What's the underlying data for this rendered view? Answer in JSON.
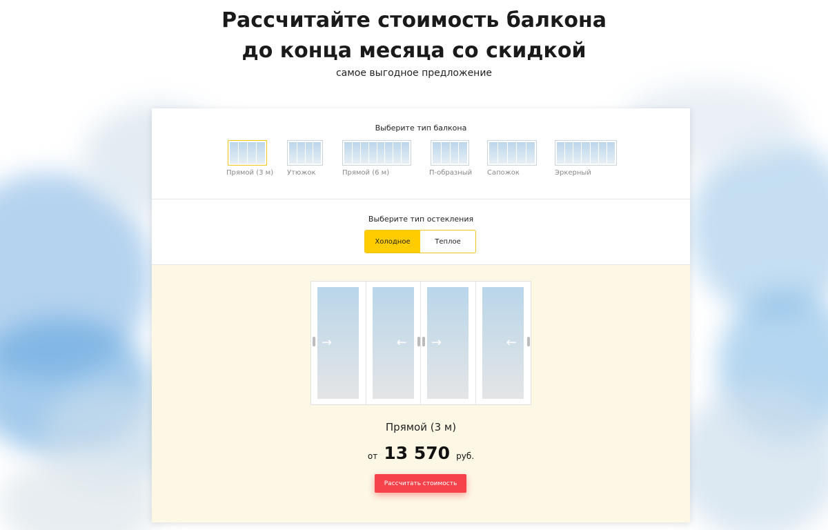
{
  "header": {
    "title_line1": "Рассчитайте стоимость балкона",
    "title_line2": "до конца месяца со скидкой",
    "subtitle": "самое выгодное предложение"
  },
  "balcony_type": {
    "label": "Выберите тип балкона",
    "options": [
      {
        "label": "Прямой (3 м)",
        "selected": true
      },
      {
        "label": "Утюжок",
        "selected": false
      },
      {
        "label": "Прямой (6 м)",
        "selected": false
      },
      {
        "label": "П-образный",
        "selected": false
      },
      {
        "label": "Сапожок",
        "selected": false
      },
      {
        "label": "Эркерный",
        "selected": false
      }
    ]
  },
  "glazing": {
    "label": "Выберите тип остекления",
    "options": [
      {
        "label": "Холодное",
        "active": true
      },
      {
        "label": "Теплое",
        "active": false
      }
    ]
  },
  "preview": {
    "window_icons": [
      "arrow-right-icon",
      "arrow-left-icon",
      "arrow-right-icon",
      "arrow-left-icon"
    ]
  },
  "result": {
    "model": "Прямой (3 м)",
    "price_prefix": "от",
    "price_value": "13 570",
    "price_currency": "руб.",
    "button": "Рассчитать стоимость"
  },
  "colors": {
    "accent_yellow": "#ffcc00",
    "button_red": "#f5424b",
    "result_bg": "#fdf8e6"
  }
}
